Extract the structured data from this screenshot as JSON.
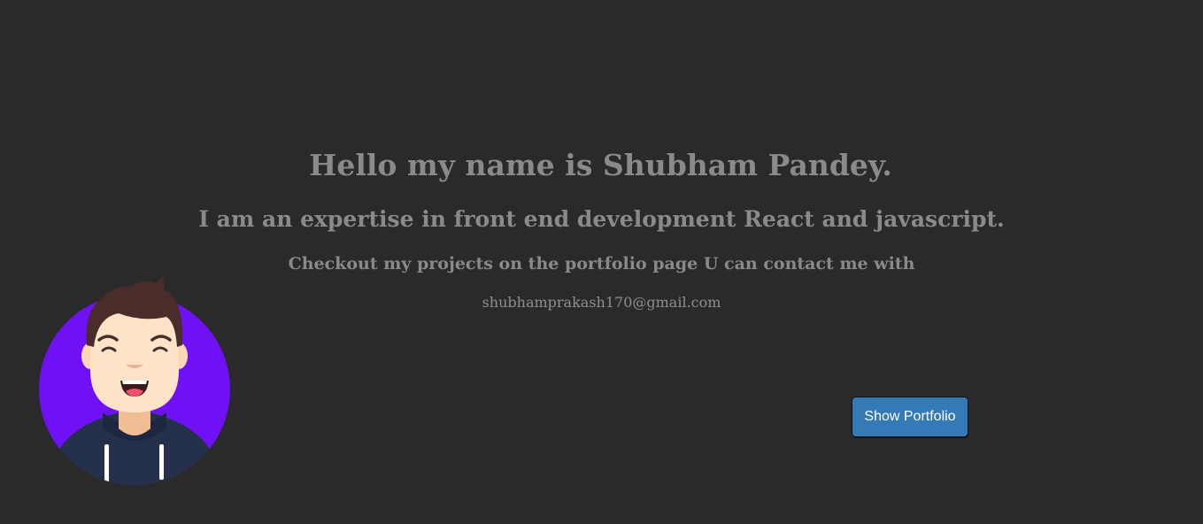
{
  "intro": {
    "headline": "Hello my name is Shubham Pandey.",
    "subheadline": "I am an expertise in front end development React and javascript.",
    "cta_text": "Checkout my projects on the portfolio page U can contact me with",
    "email": "shubhamprakash170@gmail.com"
  },
  "actions": {
    "show_portfolio_label": "Show Portfolio"
  },
  "avatar": {
    "icon": "smiling-developer-avatar",
    "background_color": "#7010f5"
  },
  "colors": {
    "page_background": "#2a2a2a",
    "text": "#8a8a8a",
    "button": "#337ab7",
    "button_text": "#ffffff"
  }
}
